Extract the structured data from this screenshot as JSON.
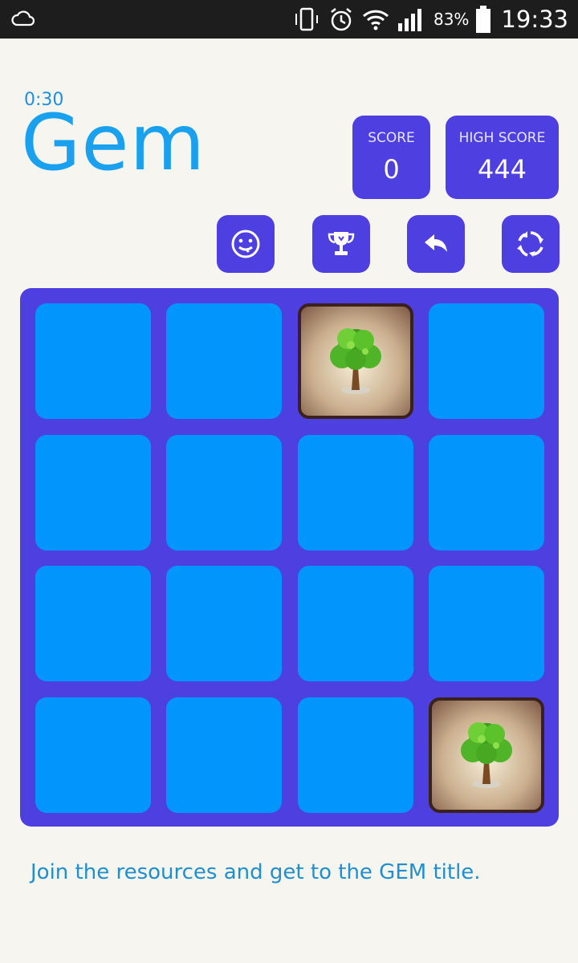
{
  "status_bar": {
    "battery_percent": "83%",
    "time": "19:33",
    "icons": [
      "cloud-icon",
      "vibrate-icon",
      "alarm-icon",
      "wifi-icon",
      "signal-icon",
      "battery-icon"
    ]
  },
  "header": {
    "timer": "0:30",
    "title": "Gem",
    "score": {
      "label": "SCORE",
      "value": "0"
    },
    "high_score": {
      "label": "HIGH SCORE",
      "value": "444"
    }
  },
  "toolbar": {
    "buttons": [
      "smiley-icon",
      "trophy-icon",
      "undo-icon",
      "restart-icon"
    ]
  },
  "board": {
    "rows": 4,
    "cols": 4,
    "tiles": [
      {
        "row": 0,
        "col": 2,
        "item": "tree"
      },
      {
        "row": 3,
        "col": 3,
        "item": "tree"
      }
    ]
  },
  "footer": {
    "hint": "Join the resources and get to the GEM title."
  },
  "colors": {
    "accent": "#4e3fe0",
    "cell": "#0295fb",
    "title": "#19a0ef",
    "background": "#f7f5ef"
  }
}
